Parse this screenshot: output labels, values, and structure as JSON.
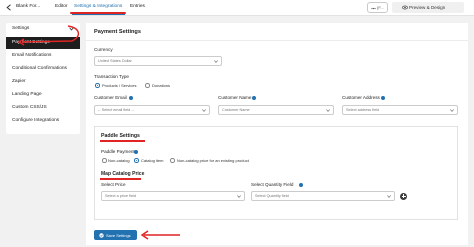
{
  "topbar": {
    "form_title": "Blank For...",
    "tabs": [
      {
        "label": "Editor",
        "active": false
      },
      {
        "label": "Settings & Integrations",
        "active": true
      },
      {
        "label": "Entries",
        "active": false
      }
    ],
    "icon_button_label": "(F...",
    "preview_label": "Preview & Design"
  },
  "sidebar": {
    "header": "Settings",
    "items": [
      {
        "label": "Payment Settings",
        "active": true
      },
      {
        "label": "Email Notifications",
        "active": false
      },
      {
        "label": "Conditional Confirmations",
        "active": false
      },
      {
        "label": "Zapier",
        "active": false
      },
      {
        "label": "Landing Page",
        "active": false
      },
      {
        "label": "Custom CSS/JS",
        "active": false
      },
      {
        "label": "Configure Integrations",
        "active": false
      }
    ]
  },
  "main": {
    "title": "Payment Settings",
    "currency": {
      "label": "Currency",
      "value": "United States Dollar"
    },
    "transaction": {
      "label": "Transaction Type",
      "options": [
        {
          "label": "Products / Services",
          "selected": true
        },
        {
          "label": "Donations",
          "selected": false
        }
      ]
    },
    "customer_email": {
      "label": "Customer Email",
      "placeholder": "-- Select email field --"
    },
    "customer_name": {
      "label": "Customer Name",
      "placeholder": "Customer Name"
    },
    "customer_address": {
      "label": "Customer Address",
      "placeholder": "Select address field"
    },
    "paddle": {
      "title": "Paddle Settings",
      "payment_label": "Paddle Payment",
      "options": [
        {
          "label": "Non-catalog",
          "selected": false
        },
        {
          "label": "Catalog item",
          "selected": true
        },
        {
          "label": "Non-catalog price for an existing product",
          "selected": false
        }
      ],
      "map_title": "Map Catalog Price",
      "select_price": {
        "label": "Select Price",
        "placeholder": "Select a price field"
      },
      "select_quantity": {
        "label": "Select Quantity Field",
        "placeholder": "Select Quantity field"
      }
    },
    "save_label": "Save Settings"
  },
  "colors": {
    "accent": "#2271b1",
    "annotation": "#e02323",
    "sidebar_active": "#1e1e1e"
  },
  "icons": [
    "back-arrow-icon",
    "dots-icon",
    "eye-icon",
    "chevron-down-icon",
    "info-icon",
    "plus-icon",
    "check-circle-icon"
  ]
}
